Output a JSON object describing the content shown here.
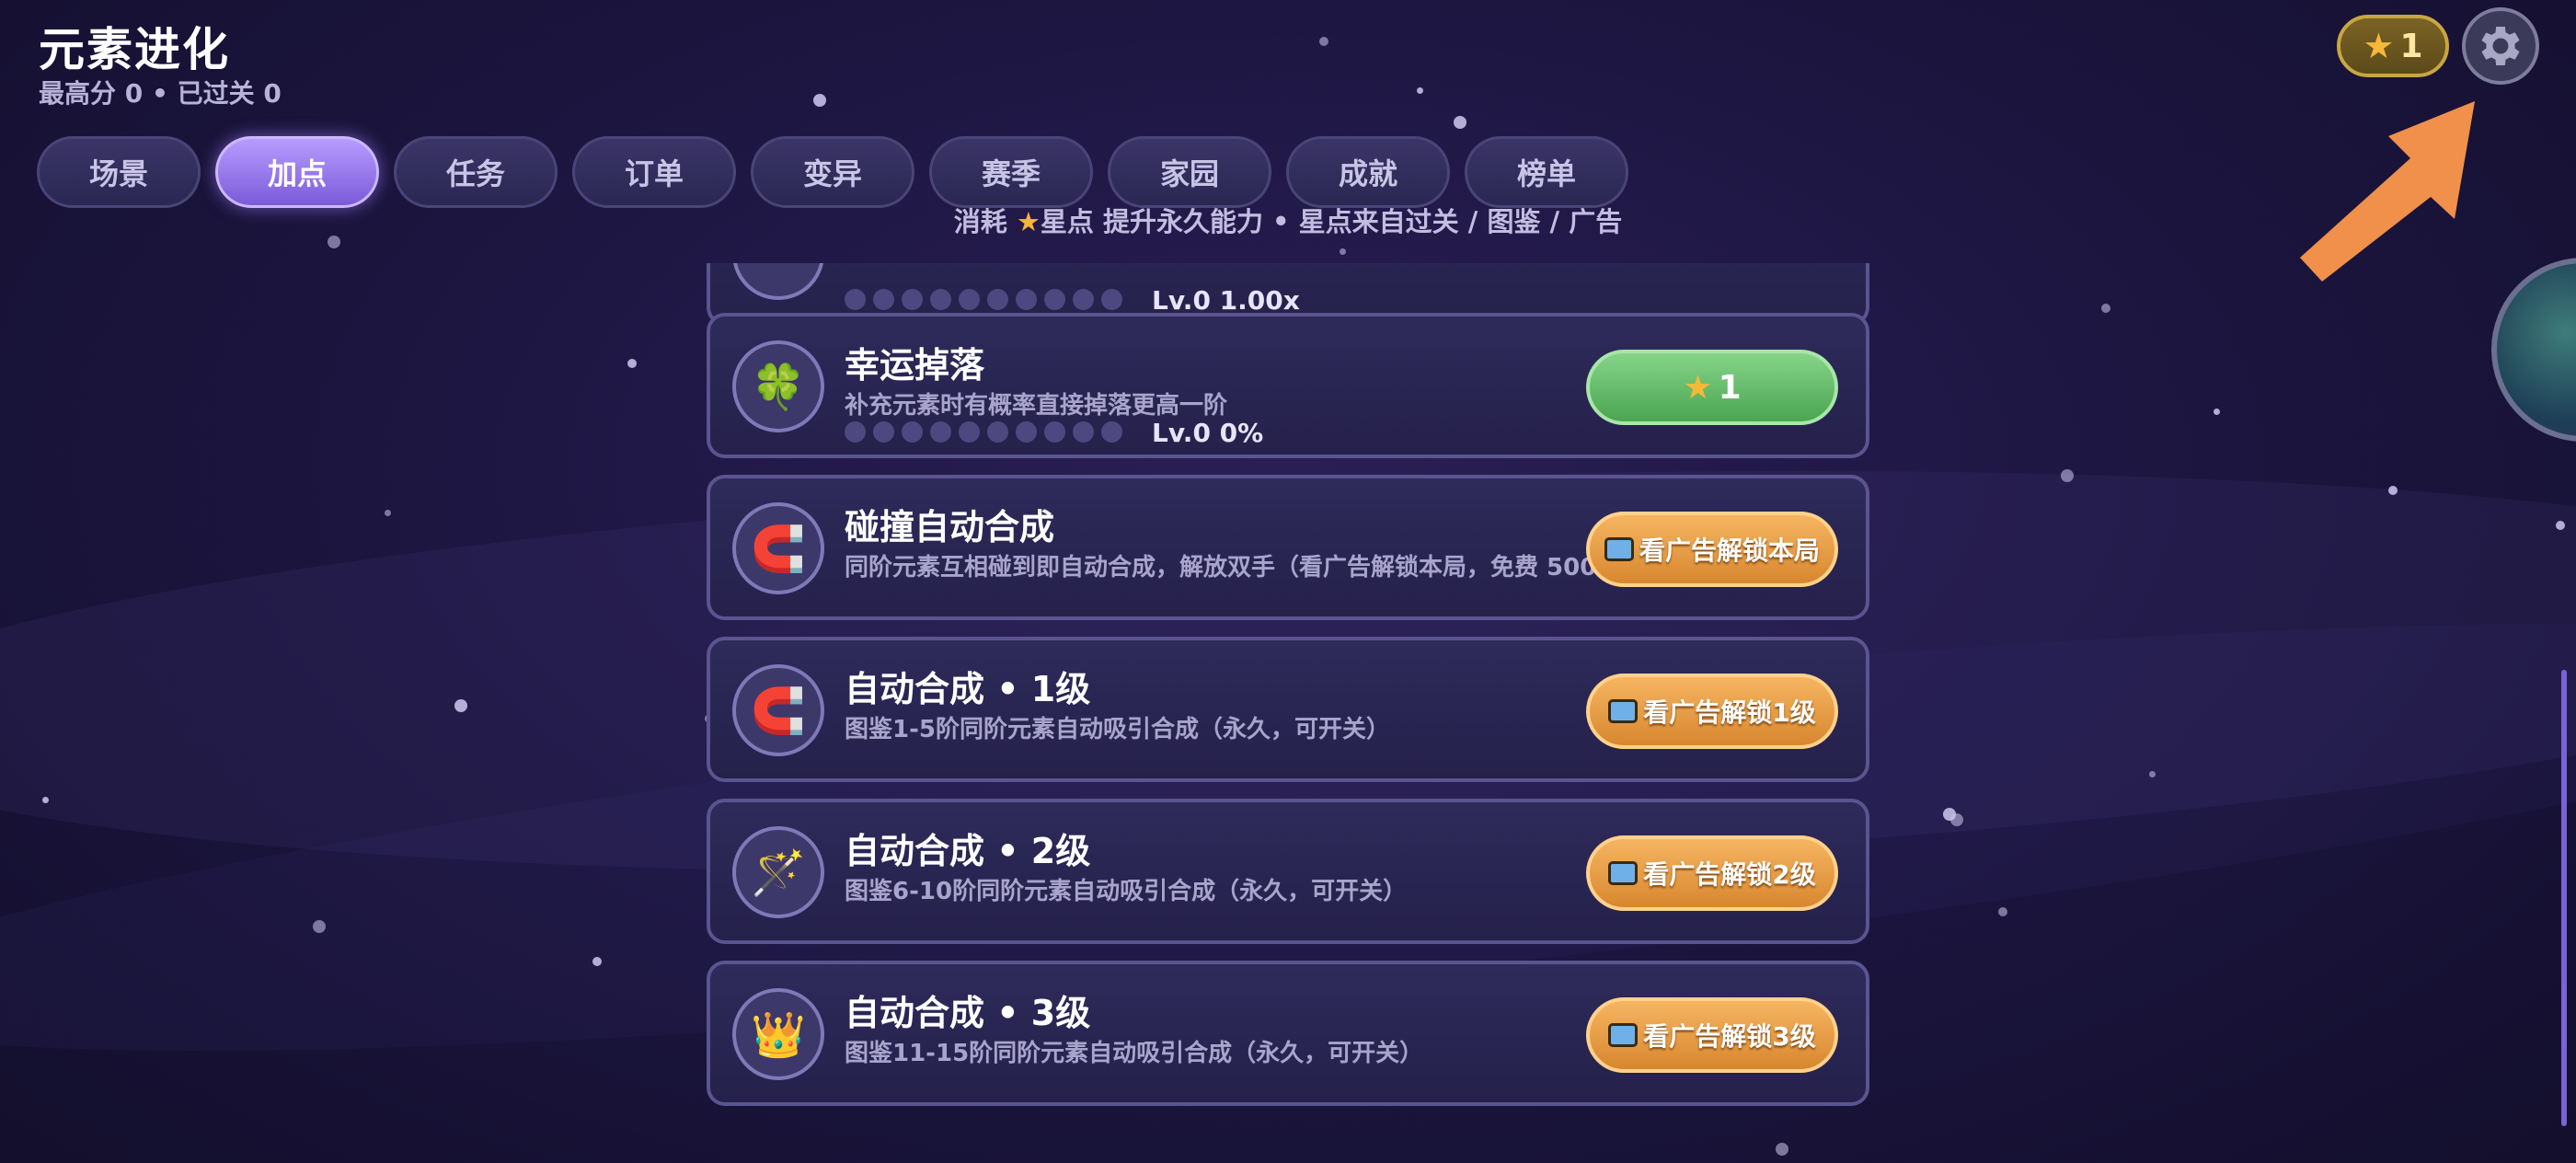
{
  "header": {
    "title": "元素进化",
    "subtitle": "最高分 0 • 已过关 0"
  },
  "tabs": [
    {
      "label": "场景",
      "active": false
    },
    {
      "label": "加点",
      "active": true
    },
    {
      "label": "任务",
      "active": false
    },
    {
      "label": "订单",
      "active": false
    },
    {
      "label": "变异",
      "active": false
    },
    {
      "label": "赛季",
      "active": false
    },
    {
      "label": "家园",
      "active": false
    },
    {
      "label": "成就",
      "active": false
    },
    {
      "label": "榜单",
      "active": false
    }
  ],
  "hint": {
    "before": "消耗 ",
    "star_icon": "★",
    "after": "星点 提升永久能力 • 星点来自过关 / 图鉴 / 广告"
  },
  "top_right": {
    "star_icon": "★",
    "star_count": "1",
    "settings_icon": "gear-icon"
  },
  "upgrades": [
    {
      "name": "",
      "desc": "",
      "level_text": "Lv.0  1.00x",
      "level_filled": 0,
      "level_max": 10,
      "icon": "",
      "button": null
    },
    {
      "name": "幸运掉落",
      "desc": "补充元素时有概率直接掉落更高一阶",
      "level_text": "Lv.0  0%",
      "level_filled": 0,
      "level_max": 10,
      "icon": "🍀",
      "icon_name": "clover-icon",
      "button": {
        "type": "star",
        "star_icon": "★",
        "label": "1"
      }
    },
    {
      "name": "碰撞自动合成",
      "desc": "同阶元素互相碰到即自动合成，解放双手（看广告解锁本局，免费 500",
      "icon": "🧲",
      "icon_name": "magnet-icon",
      "button": {
        "type": "ad",
        "label": "看广告解锁本局"
      }
    },
    {
      "name": "自动合成 • 1级",
      "desc": "图鉴1-5阶同阶元素自动吸引合成（永久，可开关）",
      "icon": "🧲",
      "icon_name": "magnet-icon",
      "button": {
        "type": "ad",
        "label": "看广告解锁1级"
      }
    },
    {
      "name": "自动合成 • 2级",
      "desc": "图鉴6-10阶同阶元素自动吸引合成（永久，可开关）",
      "icon": "🪄",
      "icon_name": "magic-wand-icon",
      "button": {
        "type": "ad",
        "label": "看广告解锁2级"
      }
    },
    {
      "name": "自动合成 • 3级",
      "desc": "图鉴11-15阶同阶元素自动吸引合成（永久，可开关）",
      "icon": "👑",
      "icon_name": "crown-icon",
      "button": {
        "type": "ad",
        "label": "看广告解锁3级"
      }
    }
  ],
  "colors": {
    "accent_purple": "#9b7cf0",
    "star_gold": "#f5b93a",
    "button_green": "#5cb860",
    "button_orange": "#e89a3e",
    "arrow_orange": "#f0904a"
  }
}
